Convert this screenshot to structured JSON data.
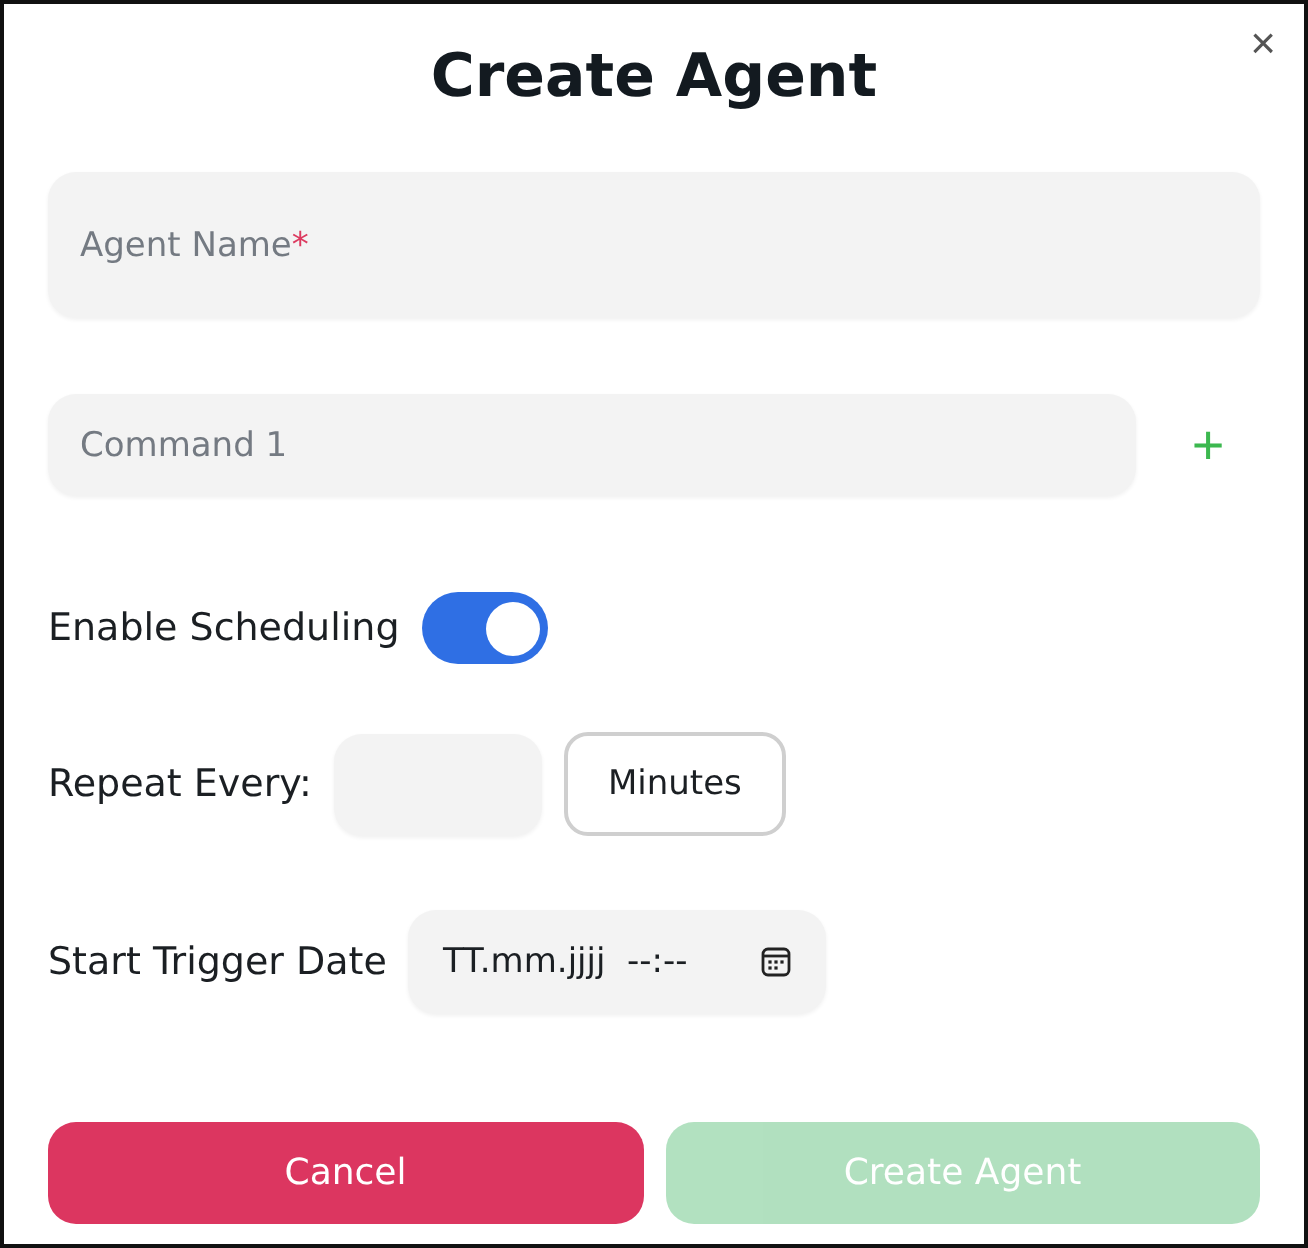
{
  "dialog": {
    "title": "Create Agent",
    "close": "×"
  },
  "agent_name": {
    "placeholder": "Agent Name",
    "required_mark": "*"
  },
  "commands": [
    {
      "placeholder": "Command 1"
    }
  ],
  "add_command": "+",
  "scheduling": {
    "label": "Enable Scheduling",
    "on": true
  },
  "repeat": {
    "label": "Repeat Every:",
    "unit": "Minutes"
  },
  "start_trigger": {
    "label": "Start Trigger Date",
    "value": "TT.mm.jjjj  --:--"
  },
  "buttons": [
    {
      "label": "Cancel",
      "kind": "cancel",
      "disabled": false
    },
    {
      "label": "Create Agent",
      "kind": "submit",
      "disabled": true
    }
  ]
}
